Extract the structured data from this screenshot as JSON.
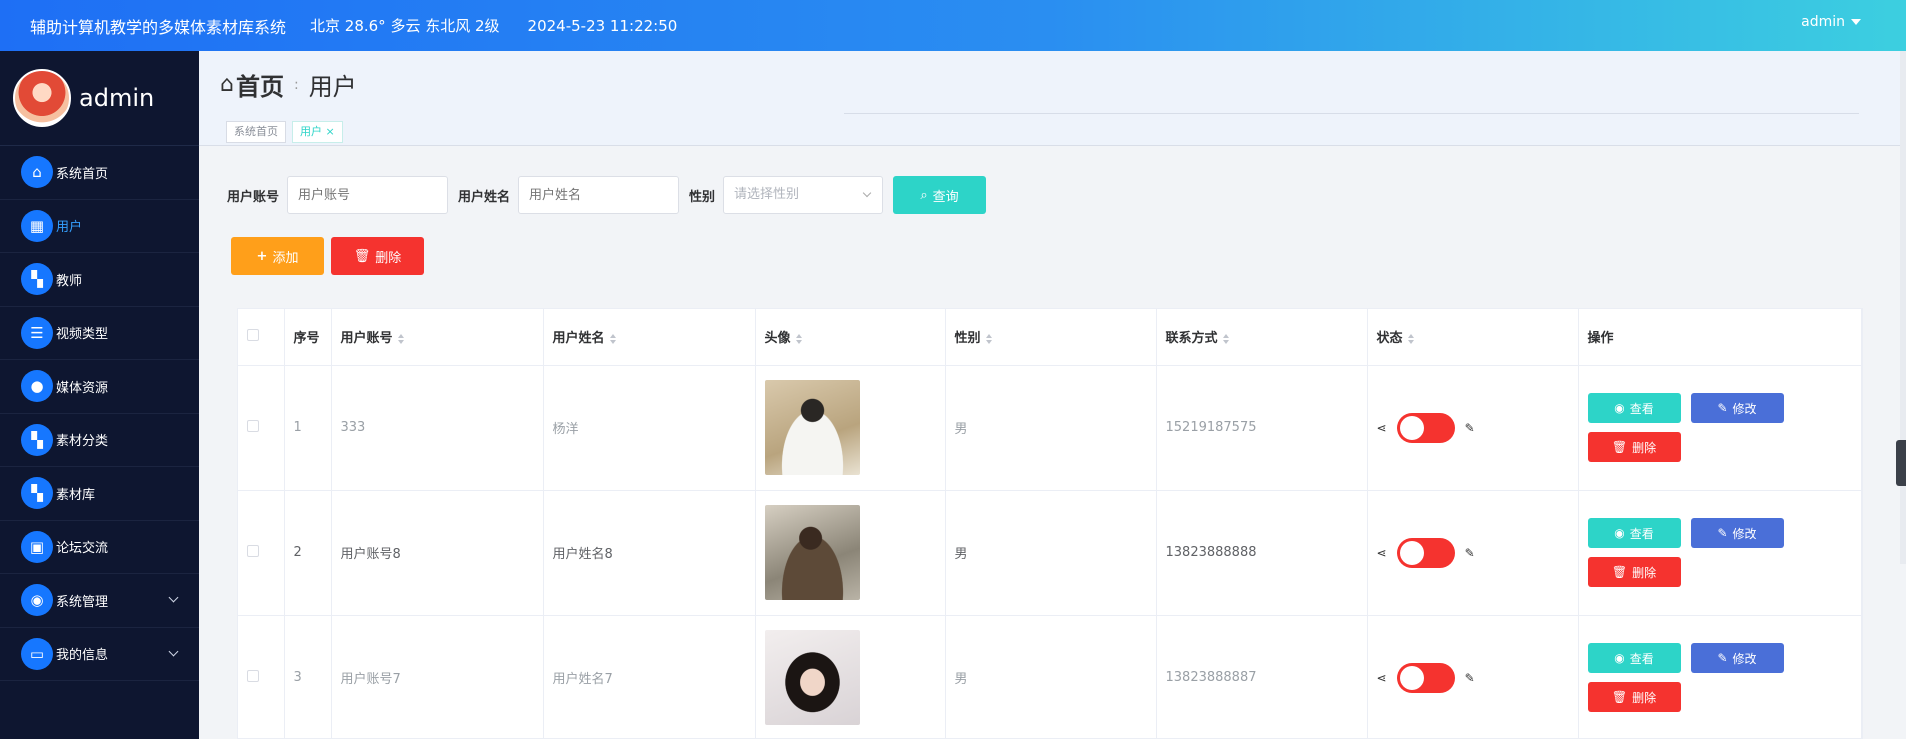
{
  "header": {
    "title": "辅助计算机教学的多媒体素材库系统",
    "weather": "北京  28.6°  多云  东北风  2级",
    "datetime": "2024-5-23 11:22:50",
    "user": "admin"
  },
  "sidebar": {
    "username": "admin",
    "items": [
      {
        "label": "系统首页",
        "icon": "home-icon"
      },
      {
        "label": "用户",
        "icon": "grid-icon"
      },
      {
        "label": "教师",
        "icon": "apps-icon"
      },
      {
        "label": "视频类型",
        "icon": "list-icon"
      },
      {
        "label": "媒体资源",
        "icon": "person-icon"
      },
      {
        "label": "素材分类",
        "icon": "apps-icon"
      },
      {
        "label": "素材库",
        "icon": "apps-icon"
      },
      {
        "label": "论坛交流",
        "icon": "briefcase-icon"
      },
      {
        "label": "系统管理",
        "icon": "bulb-icon"
      },
      {
        "label": "我的信息",
        "icon": "card-icon"
      }
    ]
  },
  "breadcrumb": {
    "home": "首页",
    "current": "用户"
  },
  "tags": {
    "home": "系统首页",
    "current": "用户"
  },
  "search": {
    "account_label": "用户账号",
    "account_placeholder": "用户账号",
    "name_label": "用户姓名",
    "name_placeholder": "用户姓名",
    "gender_label": "性别",
    "gender_placeholder": "请选择性别",
    "query_label": "查询"
  },
  "actions": {
    "add": "添加",
    "delete": "删除"
  },
  "table": {
    "headers": {
      "index": "序号",
      "account": "用户账号",
      "name": "用户姓名",
      "avatar": "头像",
      "gender": "性别",
      "contact": "联系方式",
      "status": "状态",
      "ops": "操作"
    },
    "rows": [
      {
        "index": "1",
        "account": "333",
        "name": "杨洋",
        "gender": "男",
        "contact": "15219187575"
      },
      {
        "index": "2",
        "account": "用户账号8",
        "name": "用户姓名8",
        "gender": "男",
        "contact": "13823888888"
      },
      {
        "index": "3",
        "account": "用户账号7",
        "name": "用户姓名7",
        "gender": "男",
        "contact": "13823888887"
      }
    ],
    "op_labels": {
      "view": "查看",
      "edit": "修改",
      "delete": "删除"
    }
  },
  "colors": {
    "primary": "#1677ff",
    "teal": "#2dd4c8",
    "orange": "#ff9f1a",
    "red": "#f5332f",
    "blue": "#4a6fd8"
  }
}
